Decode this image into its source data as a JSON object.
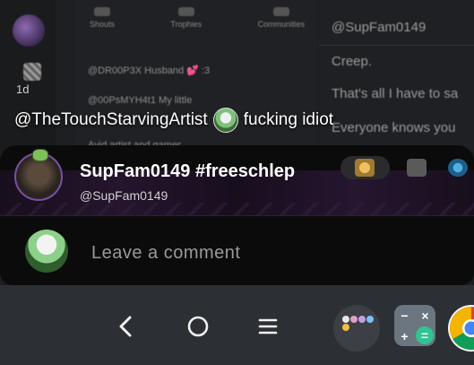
{
  "background": {
    "profile_tabs": [
      "Shouts",
      "Trophies",
      "Communities"
    ],
    "profile_lines": [
      "@DR00P3X  Husband 💕 :3",
      "@00PsMYH4t1  My little",
      "Avid artist and gamer"
    ],
    "time_label": "1d",
    "chat": {
      "handle": "@SupFam0149",
      "messages": [
        "Creep.",
        "That's all I have to sa",
        "Everyone knows you"
      ]
    }
  },
  "overlay": {
    "mention": "@TheTouchStarvingArtist",
    "text": "fucking idiot"
  },
  "post": {
    "author_name": "SupFam0149 #freeschlep",
    "author_handle": "@SupFam0149"
  },
  "comment": {
    "placeholder": "Leave a comment"
  },
  "navbar": {
    "back_icon": "back-chevron-icon",
    "home_icon": "home-circle-icon",
    "menu_icon": "menu-lines-icon",
    "calc_symbols": [
      "−",
      "×",
      "+",
      "="
    ]
  },
  "colors": {
    "sheet_bg": "#0b0b0c",
    "navbar_bg": "#2c2f33",
    "avatar_ring": "#7a4fa3",
    "calc_equals": "#31c492"
  }
}
